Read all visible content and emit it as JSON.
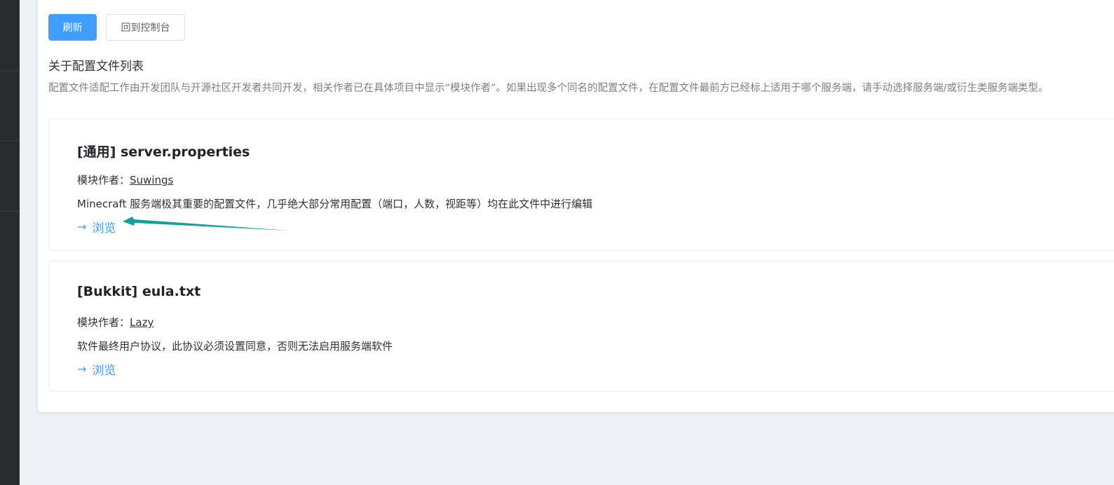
{
  "toolbar": {
    "refresh_label": "刷新",
    "console_label": "回到控制台"
  },
  "section": {
    "title": "关于配置文件列表",
    "description": "配置文件适配工作由开发团队与开源社区开发者共同开发，相关作者已在具体项目中显示“模块作者”。如果出现多个同名的配置文件，在配置文件最前方已经标上适用于哪个服务端，请手动选择服务端/或衍生类服务端类型。"
  },
  "cards": [
    {
      "title": "[通用] server.properties",
      "author_label": "模块作者：",
      "author": "Suwings",
      "description": "Minecraft 服务端极其重要的配置文件，几乎绝大部分常用配置（端口，人数，视距等）均在此文件中进行编辑",
      "link_label": "浏览"
    },
    {
      "title": "[Bukkit] eula.txt",
      "author_label": "模块作者：",
      "author": "Lazy",
      "description": "软件最终用户协议，此协议必须设置同意，否则无法启用服务端软件",
      "link_label": "浏览"
    }
  ],
  "icons": {
    "link_arrow": "arrow-right-icon",
    "annotation": "annotation-arrow-icon"
  },
  "colors": {
    "primary": "#409eff",
    "annotation": "#12a09a"
  }
}
